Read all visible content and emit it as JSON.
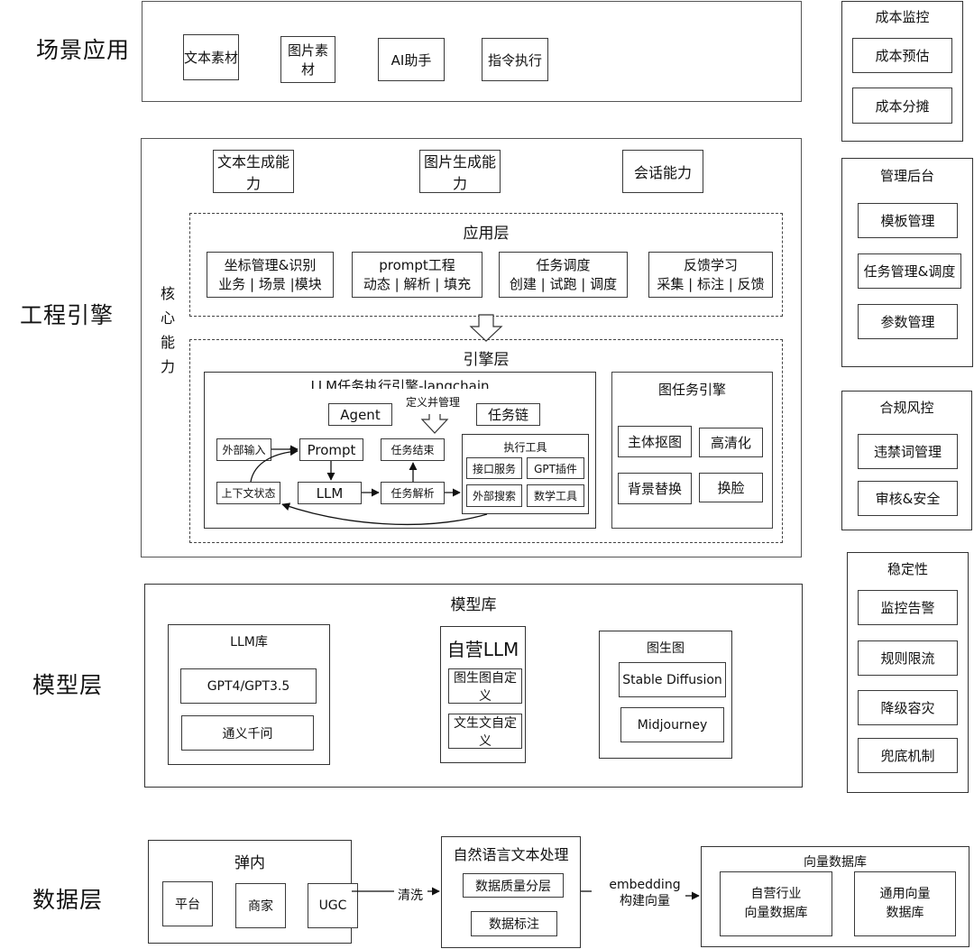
{
  "side_labels": {
    "scene": "场景应用",
    "engineering": "工程引擎",
    "model": "模型层",
    "data": "数据层"
  },
  "scene_apps": [
    "文本素材",
    "图片素材",
    "AI助手",
    "指令执行"
  ],
  "engineering": {
    "capabilities": [
      "文本生成能力",
      "图片生成能力",
      "会话能力"
    ],
    "core_label": "核心能力",
    "app_layer": {
      "title": "应用层",
      "modules": [
        {
          "title": "坐标管理&识别",
          "sub": "业务 | 场景 |模块"
        },
        {
          "title": "prompt工程",
          "sub": "动态 | 解析 | 填充"
        },
        {
          "title": "任务调度",
          "sub": "创建 | 试跑 | 调度"
        },
        {
          "title": "反馈学习",
          "sub": "采集 | 标注 | 反馈"
        }
      ]
    },
    "engine_layer": {
      "title": "引擎层",
      "llm_engine": {
        "title": "LLM任务执行引擎-langchain",
        "define_manage": "定义并管理",
        "agent": "Agent",
        "task_chain": "任务链",
        "external_input": "外部输入",
        "prompt": "Prompt",
        "context_state": "上下文状态",
        "llm": "LLM",
        "task_end": "任务结束",
        "task_parse": "任务解析",
        "tools": {
          "title": "执行工具",
          "items": [
            "接口服务",
            "GPT插件",
            "外部搜索",
            "数学工具"
          ]
        }
      },
      "image_engine": {
        "title": "图任务引擎",
        "items": [
          "主体抠图",
          "高清化",
          "背景替换",
          "换脸"
        ]
      }
    }
  },
  "model_layer": {
    "title": "模型库",
    "llm_lib": {
      "title": "LLM库",
      "items": [
        "GPT4/GPT3.5",
        "通义千问"
      ]
    },
    "self_llm": {
      "title": "自营LLM",
      "items": [
        "图生图自定义",
        "文生文自定义"
      ]
    },
    "img2img": {
      "title": "图生图",
      "items": [
        "Stable Diffusion",
        "Midjourney"
      ]
    }
  },
  "data_layer": {
    "source": {
      "title": "弹内",
      "items": [
        "平台",
        "商家",
        "UGC"
      ]
    },
    "clean_label": "清洗",
    "nlp": {
      "title": "自然语言文本处理",
      "items": [
        "数据质量分层",
        "数据标注"
      ]
    },
    "embed_label_1": "embedding",
    "embed_label_2": "构建向量",
    "vector_db": {
      "title": "向量数据库",
      "items": [
        "自营行业\n向量数据库",
        "通用向量\n数据库"
      ]
    }
  },
  "right_panels": [
    {
      "title": "成本监控",
      "items": [
        "成本预估",
        "成本分摊"
      ]
    },
    {
      "title": "管理后台",
      "items": [
        "模板管理",
        "任务管理&调度",
        "参数管理"
      ]
    },
    {
      "title": "合规风控",
      "items": [
        "违禁词管理",
        "审核&安全"
      ]
    },
    {
      "title": "稳定性",
      "items": [
        "监控告警",
        "规则限流",
        "降级容灾",
        "兜底机制"
      ]
    }
  ]
}
